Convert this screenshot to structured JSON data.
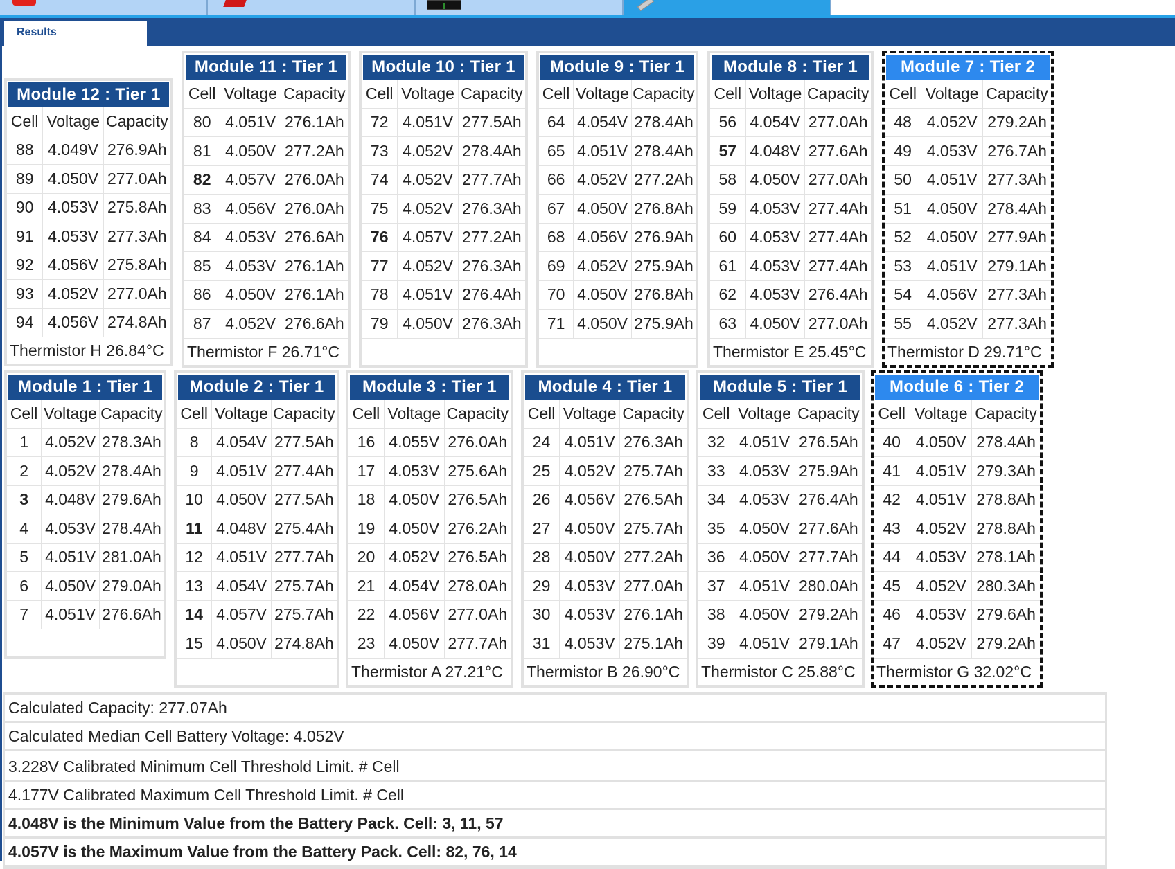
{
  "results_tab": "Results",
  "modules": [
    {
      "title": "Module 12 : Tier 1",
      "headers": [
        "Cell",
        "Voltage",
        "Capacity"
      ],
      "rows": [
        [
          "88",
          "4.049V",
          "276.9Ah"
        ],
        [
          "89",
          "4.050V",
          "277.0Ah"
        ],
        [
          "90",
          "4.053V",
          "275.8Ah"
        ],
        [
          "91",
          "4.053V",
          "277.3Ah"
        ],
        [
          "92",
          "4.056V",
          "275.8Ah"
        ],
        [
          "93",
          "4.052V",
          "277.0Ah"
        ],
        [
          "94",
          "4.056V",
          "274.8Ah"
        ]
      ],
      "highlight_rows": [],
      "thermistor": "Thermistor H 26.84°C"
    },
    {
      "title": "Module 11 : Tier 1",
      "headers": [
        "Cell",
        "Voltage",
        "Capacity"
      ],
      "rows": [
        [
          "80",
          "4.051V",
          "276.1Ah"
        ],
        [
          "81",
          "4.050V",
          "277.2Ah"
        ],
        [
          "82",
          "4.057V",
          "276.0Ah"
        ],
        [
          "83",
          "4.056V",
          "276.0Ah"
        ],
        [
          "84",
          "4.053V",
          "276.6Ah"
        ],
        [
          "85",
          "4.053V",
          "276.1Ah"
        ],
        [
          "86",
          "4.050V",
          "276.1Ah"
        ],
        [
          "87",
          "4.052V",
          "276.6Ah"
        ]
      ],
      "highlight_rows": [
        2
      ],
      "thermistor": "Thermistor F 26.71°C"
    },
    {
      "title": "Module 10 : Tier 1",
      "headers": [
        "Cell",
        "Voltage",
        "Capacity"
      ],
      "rows": [
        [
          "72",
          "4.051V",
          "277.5Ah"
        ],
        [
          "73",
          "4.052V",
          "278.4Ah"
        ],
        [
          "74",
          "4.052V",
          "277.7Ah"
        ],
        [
          "75",
          "4.052V",
          "276.3Ah"
        ],
        [
          "76",
          "4.057V",
          "277.2Ah"
        ],
        [
          "77",
          "4.052V",
          "276.3Ah"
        ],
        [
          "78",
          "4.051V",
          "276.4Ah"
        ],
        [
          "79",
          "4.050V",
          "276.3Ah"
        ]
      ],
      "highlight_rows": [
        4
      ],
      "thermistor": ""
    },
    {
      "title": "Module 9 : Tier 1",
      "headers": [
        "Cell",
        "Voltage",
        "Capacity"
      ],
      "rows": [
        [
          "64",
          "4.054V",
          "278.4Ah"
        ],
        [
          "65",
          "4.051V",
          "278.4Ah"
        ],
        [
          "66",
          "4.052V",
          "277.2Ah"
        ],
        [
          "67",
          "4.050V",
          "276.8Ah"
        ],
        [
          "68",
          "4.056V",
          "276.9Ah"
        ],
        [
          "69",
          "4.052V",
          "275.9Ah"
        ],
        [
          "70",
          "4.050V",
          "276.8Ah"
        ],
        [
          "71",
          "4.050V",
          "275.9Ah"
        ]
      ],
      "highlight_rows": [],
      "thermistor": ""
    },
    {
      "title": "Module 8 : Tier 1",
      "headers": [
        "Cell",
        "Voltage",
        "Capacity"
      ],
      "rows": [
        [
          "56",
          "4.054V",
          "277.0Ah"
        ],
        [
          "57",
          "4.048V",
          "277.6Ah"
        ],
        [
          "58",
          "4.050V",
          "277.0Ah"
        ],
        [
          "59",
          "4.053V",
          "277.4Ah"
        ],
        [
          "60",
          "4.053V",
          "277.4Ah"
        ],
        [
          "61",
          "4.053V",
          "277.4Ah"
        ],
        [
          "62",
          "4.053V",
          "276.4Ah"
        ],
        [
          "63",
          "4.050V",
          "277.0Ah"
        ]
      ],
      "highlight_rows": [
        1
      ],
      "thermistor": "Thermistor E 25.45°C"
    },
    {
      "title": "Module 7 : Tier 2",
      "headers": [
        "Cell",
        "Voltage",
        "Capacity"
      ],
      "rows": [
        [
          "48",
          "4.052V",
          "279.2Ah"
        ],
        [
          "49",
          "4.053V",
          "276.7Ah"
        ],
        [
          "50",
          "4.051V",
          "277.3Ah"
        ],
        [
          "51",
          "4.050V",
          "278.4Ah"
        ],
        [
          "52",
          "4.050V",
          "277.9Ah"
        ],
        [
          "53",
          "4.051V",
          "279.1Ah"
        ],
        [
          "54",
          "4.056V",
          "277.3Ah"
        ],
        [
          "55",
          "4.052V",
          "277.3Ah"
        ]
      ],
      "highlight_rows": [],
      "thermistor": "Thermistor D 29.71°C"
    },
    {
      "title": "Module 1 : Tier 1",
      "headers": [
        "Cell",
        "Voltage",
        "Capacity"
      ],
      "rows": [
        [
          "1",
          "4.052V",
          "278.3Ah"
        ],
        [
          "2",
          "4.052V",
          "278.4Ah"
        ],
        [
          "3",
          "4.048V",
          "279.6Ah"
        ],
        [
          "4",
          "4.053V",
          "278.4Ah"
        ],
        [
          "5",
          "4.051V",
          "281.0Ah"
        ],
        [
          "6",
          "4.050V",
          "279.0Ah"
        ],
        [
          "7",
          "4.051V",
          "276.6Ah"
        ]
      ],
      "highlight_rows": [
        2
      ],
      "thermistor": ""
    },
    {
      "title": "Module 2 : Tier 1",
      "headers": [
        "Cell",
        "Voltage",
        "Capacity"
      ],
      "rows": [
        [
          "8",
          "4.054V",
          "277.5Ah"
        ],
        [
          "9",
          "4.051V",
          "277.4Ah"
        ],
        [
          "10",
          "4.050V",
          "277.5Ah"
        ],
        [
          "11",
          "4.048V",
          "275.4Ah"
        ],
        [
          "12",
          "4.051V",
          "277.7Ah"
        ],
        [
          "13",
          "4.054V",
          "275.7Ah"
        ],
        [
          "14",
          "4.057V",
          "275.7Ah"
        ],
        [
          "15",
          "4.050V",
          "274.8Ah"
        ]
      ],
      "highlight_rows": [
        3,
        6
      ],
      "thermistor": ""
    },
    {
      "title": "Module 3 : Tier 1",
      "headers": [
        "Cell",
        "Voltage",
        "Capacity"
      ],
      "rows": [
        [
          "16",
          "4.055V",
          "276.0Ah"
        ],
        [
          "17",
          "4.053V",
          "275.6Ah"
        ],
        [
          "18",
          "4.050V",
          "276.5Ah"
        ],
        [
          "19",
          "4.050V",
          "276.2Ah"
        ],
        [
          "20",
          "4.052V",
          "276.5Ah"
        ],
        [
          "21",
          "4.054V",
          "278.0Ah"
        ],
        [
          "22",
          "4.056V",
          "277.0Ah"
        ],
        [
          "23",
          "4.050V",
          "277.7Ah"
        ]
      ],
      "highlight_rows": [],
      "thermistor": "Thermistor A 27.21°C"
    },
    {
      "title": "Module 4 : Tier 1",
      "headers": [
        "Cell",
        "Voltage",
        "Capacity"
      ],
      "rows": [
        [
          "24",
          "4.051V",
          "276.3Ah"
        ],
        [
          "25",
          "4.052V",
          "275.7Ah"
        ],
        [
          "26",
          "4.056V",
          "276.5Ah"
        ],
        [
          "27",
          "4.050V",
          "275.7Ah"
        ],
        [
          "28",
          "4.050V",
          "277.2Ah"
        ],
        [
          "29",
          "4.053V",
          "277.0Ah"
        ],
        [
          "30",
          "4.053V",
          "276.1Ah"
        ],
        [
          "31",
          "4.053V",
          "275.1Ah"
        ]
      ],
      "highlight_rows": [],
      "thermistor": "Thermistor B 26.90°C"
    },
    {
      "title": "Module 5 : Tier 1",
      "headers": [
        "Cell",
        "Voltage",
        "Capacity"
      ],
      "rows": [
        [
          "32",
          "4.051V",
          "276.5Ah"
        ],
        [
          "33",
          "4.053V",
          "275.9Ah"
        ],
        [
          "34",
          "4.053V",
          "276.4Ah"
        ],
        [
          "35",
          "4.050V",
          "277.6Ah"
        ],
        [
          "36",
          "4.050V",
          "277.7Ah"
        ],
        [
          "37",
          "4.051V",
          "280.0Ah"
        ],
        [
          "38",
          "4.050V",
          "279.2Ah"
        ],
        [
          "39",
          "4.051V",
          "279.1Ah"
        ]
      ],
      "highlight_rows": [],
      "thermistor": "Thermistor C 25.88°C"
    },
    {
      "title": "Module 6 : Tier 2",
      "headers": [
        "Cell",
        "Voltage",
        "Capacity"
      ],
      "rows": [
        [
          "40",
          "4.050V",
          "278.4Ah"
        ],
        [
          "41",
          "4.051V",
          "279.3Ah"
        ],
        [
          "42",
          "4.051V",
          "278.8Ah"
        ],
        [
          "43",
          "4.052V",
          "278.8Ah"
        ],
        [
          "44",
          "4.053V",
          "278.1Ah"
        ],
        [
          "45",
          "4.052V",
          "280.3Ah"
        ],
        [
          "46",
          "4.053V",
          "279.6Ah"
        ],
        [
          "47",
          "4.052V",
          "279.2Ah"
        ]
      ],
      "highlight_rows": [],
      "thermistor": "Thermistor G 32.02°C"
    }
  ],
  "summary": {
    "calculated_capacity": "Calculated Capacity: 277.07Ah",
    "median_voltage": "Calculated Median Cell Battery Voltage: 4.052V",
    "min_threshold": "3.228V Calibrated Minimum Cell Threshold Limit. # Cell",
    "max_threshold": "4.177V Calibrated Maximum Cell Threshold Limit. # Cell",
    "min_value": "4.048V is the Minimum Value from the Battery Pack. Cell: 3, 11, 57",
    "max_value": "4.057V is the Maximum Value from the Battery Pack. Cell: 82, 76, 14"
  },
  "colors": {
    "header_bar": "#1f4e91",
    "tier1_title": "#1a4d8f",
    "tier2_title": "#2d89ee",
    "toolbar_tab": "#b3d4f6",
    "toolbar_active": "#2aa0e6"
  },
  "toolbar_icons": [
    "red-tool-icon",
    "red-cube-icon",
    "screen-icon",
    "pen-icon"
  ]
}
